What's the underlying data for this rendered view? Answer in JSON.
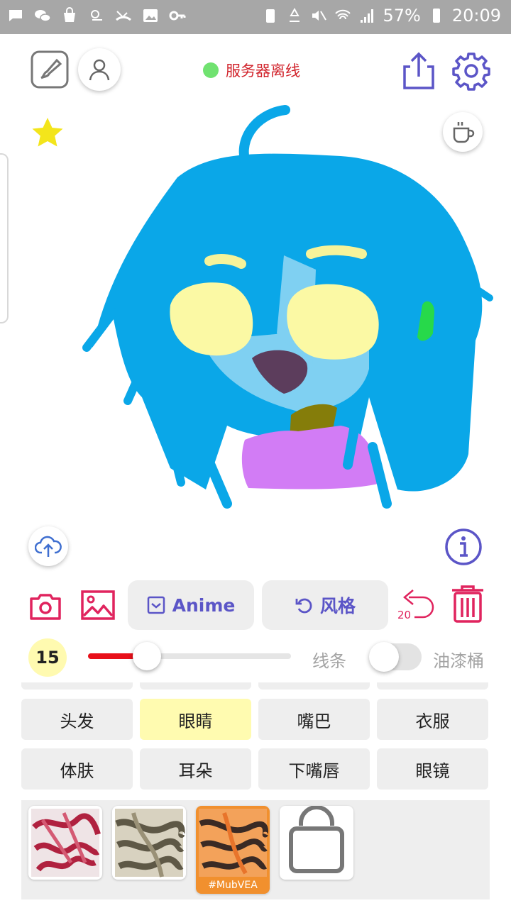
{
  "status_bar": {
    "battery": "57%",
    "time": "20:09"
  },
  "header": {
    "server_status": "服务器离线",
    "server_status_color": "#70e270"
  },
  "canvas": {
    "subject": "hand-drawn anime face"
  },
  "toolbar": {
    "anime_label": "Anime",
    "style_label": "风格",
    "undo_count": "20"
  },
  "brush": {
    "size": "15",
    "size_fraction": 0.29,
    "lines_label": "线条",
    "bucket_label": "油漆桶",
    "bucket_enabled": false
  },
  "parts": [
    {
      "label": "头发",
      "selected": false
    },
    {
      "label": "眼睛",
      "selected": true
    },
    {
      "label": "嘴巴",
      "selected": false
    },
    {
      "label": "衣服",
      "selected": false
    },
    {
      "label": "体肤",
      "selected": false
    },
    {
      "label": "耳朵",
      "selected": false
    },
    {
      "label": "下嘴唇",
      "selected": false
    },
    {
      "label": "眼镜",
      "selected": false
    }
  ],
  "styles": {
    "active_tag": "#MubVEA"
  },
  "colors": {
    "accent": "#5b55c7",
    "danger": "#e0245e",
    "slider": "#e8101a",
    "selected_part": "#fffbb0"
  }
}
